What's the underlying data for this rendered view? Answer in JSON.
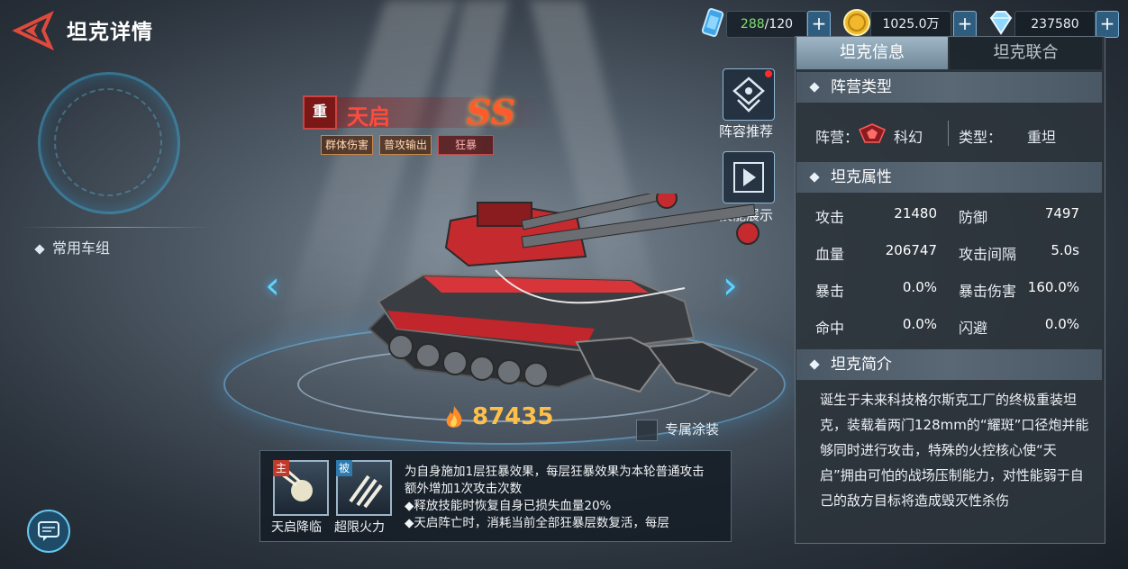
{
  "header": {
    "title": "坦克详情"
  },
  "resources": {
    "energy": {
      "current": "288",
      "max": "/120"
    },
    "gold": "1025.0万",
    "diamond": "237580"
  },
  "left": {
    "common_group": "常用车组"
  },
  "tank": {
    "class_badge": "重",
    "name": "天启",
    "grade": "SS",
    "tags": [
      "群体伤害",
      "普攻输出",
      "狂暴"
    ],
    "power": "87435",
    "exclusive_skin": "专属涂装"
  },
  "side_buttons": {
    "lineup": "阵容推荐",
    "skill_show": "技能展示"
  },
  "skills": [
    {
      "type_tag": "主",
      "name": "天启降临"
    },
    {
      "type_tag": "被",
      "name": "超限火力"
    }
  ],
  "skill_description": "为自身施加1层狂暴效果，每层狂暴效果为本轮普通攻击额外增加1次攻击次数\n◆释放技能时恢复自身已损失血量20%\n◆天启阵亡时，消耗当前全部狂暴层数复活，每层",
  "panel": {
    "tabs": [
      "坦克信息",
      "坦克联合"
    ],
    "section_faction": "阵营类型",
    "faction_label": "阵营：",
    "faction_value": "科幻",
    "type_label": "类型：",
    "type_value": "重坦",
    "section_attrs": "坦克属性",
    "attrs": [
      {
        "label": "攻击",
        "value": "21480"
      },
      {
        "label": "防御",
        "value": "7497"
      },
      {
        "label": "血量",
        "value": "206747"
      },
      {
        "label": "攻击间隔",
        "value": "5.0s"
      },
      {
        "label": "暴击",
        "value": "0.0%"
      },
      {
        "label": "暴击伤害",
        "value": "160.0%"
      },
      {
        "label": "命中",
        "value": "0.0%"
      },
      {
        "label": "闪避",
        "value": "0.0%"
      }
    ],
    "section_intro": "坦克简介",
    "intro": "诞生于未来科技格尔斯克工厂的终极重装坦克，装载着两门128mm的“耀斑”口径炮并能够同时进行攻击，特殊的火控核心使“天启”拥由可怕的战场压制能力，对性能弱于自己的敌方目标将造成毁灭性杀伤"
  },
  "colors": {
    "accent_blue": "#5fd2ff",
    "tank_red": "#ff4b3a",
    "power_gold": "#ffc04a"
  }
}
